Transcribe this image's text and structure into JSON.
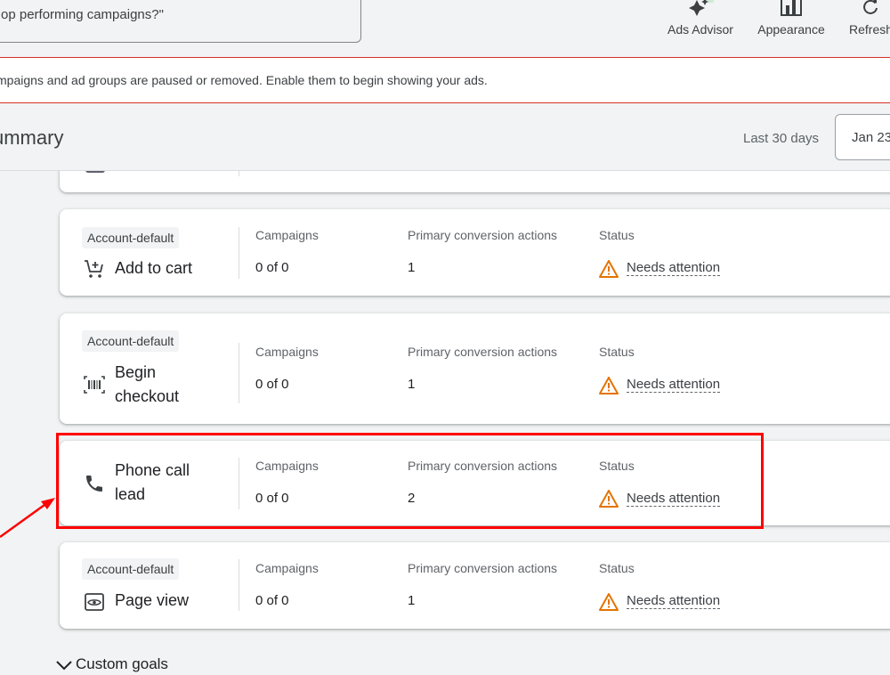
{
  "toolbar": {
    "search_text": "op performing campaigns?\"",
    "ads_advisor_label": "Ads Advisor",
    "appearance_label": "Appearance",
    "refresh_label": "Refresh"
  },
  "banner": {
    "message": "mpaigns and ad groups are paused or removed. Enable them to begin showing your ads."
  },
  "summary": {
    "title": "ummary",
    "date_range_label": "Last 30 days",
    "date_button": "Jan 23"
  },
  "columns": {
    "campaigns": "Campaigns",
    "primary": "Primary conversion actions",
    "status": "Status"
  },
  "cards": [
    {
      "badge": "Account-default",
      "name": "Add to cart",
      "campaigns": "0 of 0",
      "primary": "1",
      "status": "Needs attention",
      "icon": "cart-icon"
    },
    {
      "badge": "Account-default",
      "name": "Begin checkout",
      "name_line1": "Begin",
      "name_line2": "checkout",
      "campaigns": "0 of 0",
      "primary": "1",
      "status": "Needs attention",
      "icon": "barcode-icon"
    },
    {
      "name": "Phone call lead",
      "name_line1": "Phone call",
      "name_line2": "lead",
      "campaigns": "0 of 0",
      "primary": "2",
      "status": "Needs attention",
      "icon": "phone-icon"
    },
    {
      "badge": "Account-default",
      "name": "Page view",
      "campaigns": "0 of 0",
      "primary": "1",
      "status": "Needs attention",
      "icon": "eye-icon"
    }
  ],
  "footer": {
    "custom_goals_label": "Custom goals"
  },
  "colors": {
    "alert_red": "#d93025",
    "warning_orange": "#e37400",
    "highlight_red": "#ff0000"
  }
}
